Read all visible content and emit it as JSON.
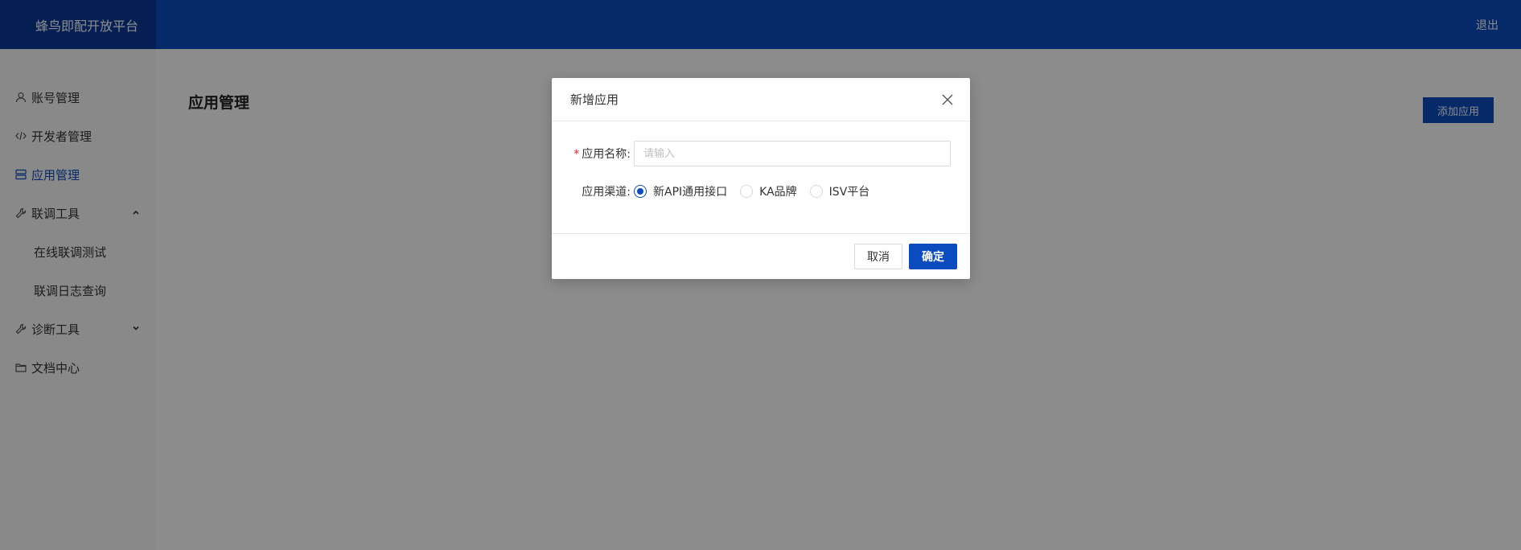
{
  "header": {
    "brand": "蜂鸟即配开放平台",
    "logout": "退出"
  },
  "sidebar": {
    "items": [
      {
        "label": "账号管理",
        "icon": "user-icon"
      },
      {
        "label": "开发者管理",
        "icon": "code-icon"
      },
      {
        "label": "应用管理",
        "icon": "server-icon"
      },
      {
        "label": "联调工具",
        "icon": "wrench-icon"
      },
      {
        "label": "在线联调测试"
      },
      {
        "label": "联调日志查询"
      },
      {
        "label": "诊断工具",
        "icon": "wrench-icon"
      },
      {
        "label": "文档中心",
        "icon": "folder-icon"
      }
    ]
  },
  "main": {
    "title": "应用管理",
    "add_button": "添加应用"
  },
  "modal": {
    "title": "新增应用",
    "name_label": "应用名称:",
    "name_placeholder": "请输入",
    "channel_label": "应用渠道:",
    "channel_options": [
      "新API通用接口",
      "KA品牌",
      "ISV平台"
    ],
    "channel_selected": "新API通用接口",
    "cancel": "取消",
    "ok": "确定"
  },
  "colors": {
    "primary": "#0a4bbf",
    "header": "#0a4bbf",
    "brand_bg": "#0a3a9c",
    "required": "#f5222d"
  }
}
